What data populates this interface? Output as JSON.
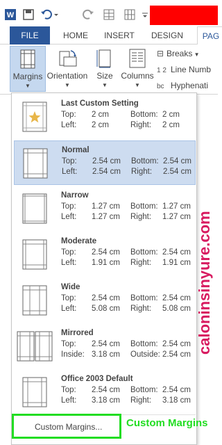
{
  "qat": {
    "icons": [
      "word-icon",
      "save-icon",
      "undo-icon",
      "undo-dropdown-icon",
      "redo-icon",
      "table-icon",
      "grid-icon",
      "customize-icon"
    ],
    "redacted_color": "#ff0000"
  },
  "tabs": [
    "FILE",
    "HOME",
    "INSERT",
    "DESIGN",
    "PAG"
  ],
  "ribbon": {
    "margins": "Margins",
    "orientation": "Orientation",
    "size": "Size",
    "columns": "Columns",
    "breaks": "Breaks",
    "line_numbers": "Line Numb",
    "hyphenation": "Hyphenati"
  },
  "presets": [
    {
      "title": "Last Custom Setting",
      "k1": "Top:",
      "v1": "2 cm",
      "k2": "Bottom:",
      "v2": "2 cm",
      "k3": "Left:",
      "v3": "2 cm",
      "k4": "Right:",
      "v4": "2 cm"
    },
    {
      "title": "Normal",
      "k1": "Top:",
      "v1": "2.54 cm",
      "k2": "Bottom:",
      "v2": "2.54 cm",
      "k3": "Left:",
      "v3": "2.54 cm",
      "k4": "Right:",
      "v4": "2.54 cm"
    },
    {
      "title": "Narrow",
      "k1": "Top:",
      "v1": "1.27 cm",
      "k2": "Bottom:",
      "v2": "1.27 cm",
      "k3": "Left:",
      "v3": "1.27 cm",
      "k4": "Right:",
      "v4": "1.27 cm"
    },
    {
      "title": "Moderate",
      "k1": "Top:",
      "v1": "2.54 cm",
      "k2": "Bottom:",
      "v2": "2.54 cm",
      "k3": "Left:",
      "v3": "1.91 cm",
      "k4": "Right:",
      "v4": "1.91 cm"
    },
    {
      "title": "Wide",
      "k1": "Top:",
      "v1": "2.54 cm",
      "k2": "Bottom:",
      "v2": "2.54 cm",
      "k3": "Left:",
      "v3": "5.08 cm",
      "k4": "Right:",
      "v4": "5.08 cm"
    },
    {
      "title": "Mirrored",
      "k1": "Top:",
      "v1": "2.54 cm",
      "k2": "Bottom:",
      "v2": "2.54 cm",
      "k3": "Inside:",
      "v3": "3.18 cm",
      "k4": "Outside:",
      "v4": "2.54 cm"
    },
    {
      "title": "Office 2003 Default",
      "k1": "Top:",
      "v1": "2.54 cm",
      "k2": "Bottom:",
      "v2": "2.54 cm",
      "k3": "Left:",
      "v3": "3.18 cm",
      "k4": "Right:",
      "v4": "3.18 cm"
    }
  ],
  "custom_margins": "Custom Margins...",
  "annotation": "Custom Margins",
  "watermark": "caloninsinyure.com",
  "colors": {
    "file_tab": "#2b579a",
    "selected_item": "#cddcf0",
    "highlight_box": "#22dd22",
    "watermark": "#d81b60"
  }
}
